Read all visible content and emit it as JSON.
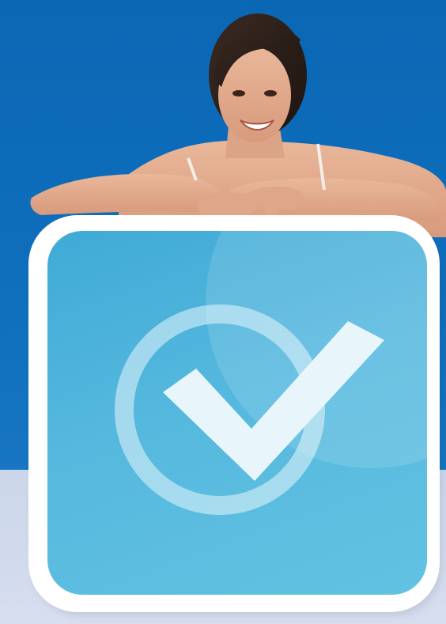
{
  "image": {
    "subject": "woman-leaning-on-sign",
    "icon": "checkmark-in-circle-icon"
  },
  "colors": {
    "background_top": "#0f6fbd",
    "background_bottom": "#cfd9ec",
    "card_frame": "#ffffff",
    "card_face": "#55b8de",
    "checkmark": "#e8f6fb"
  }
}
